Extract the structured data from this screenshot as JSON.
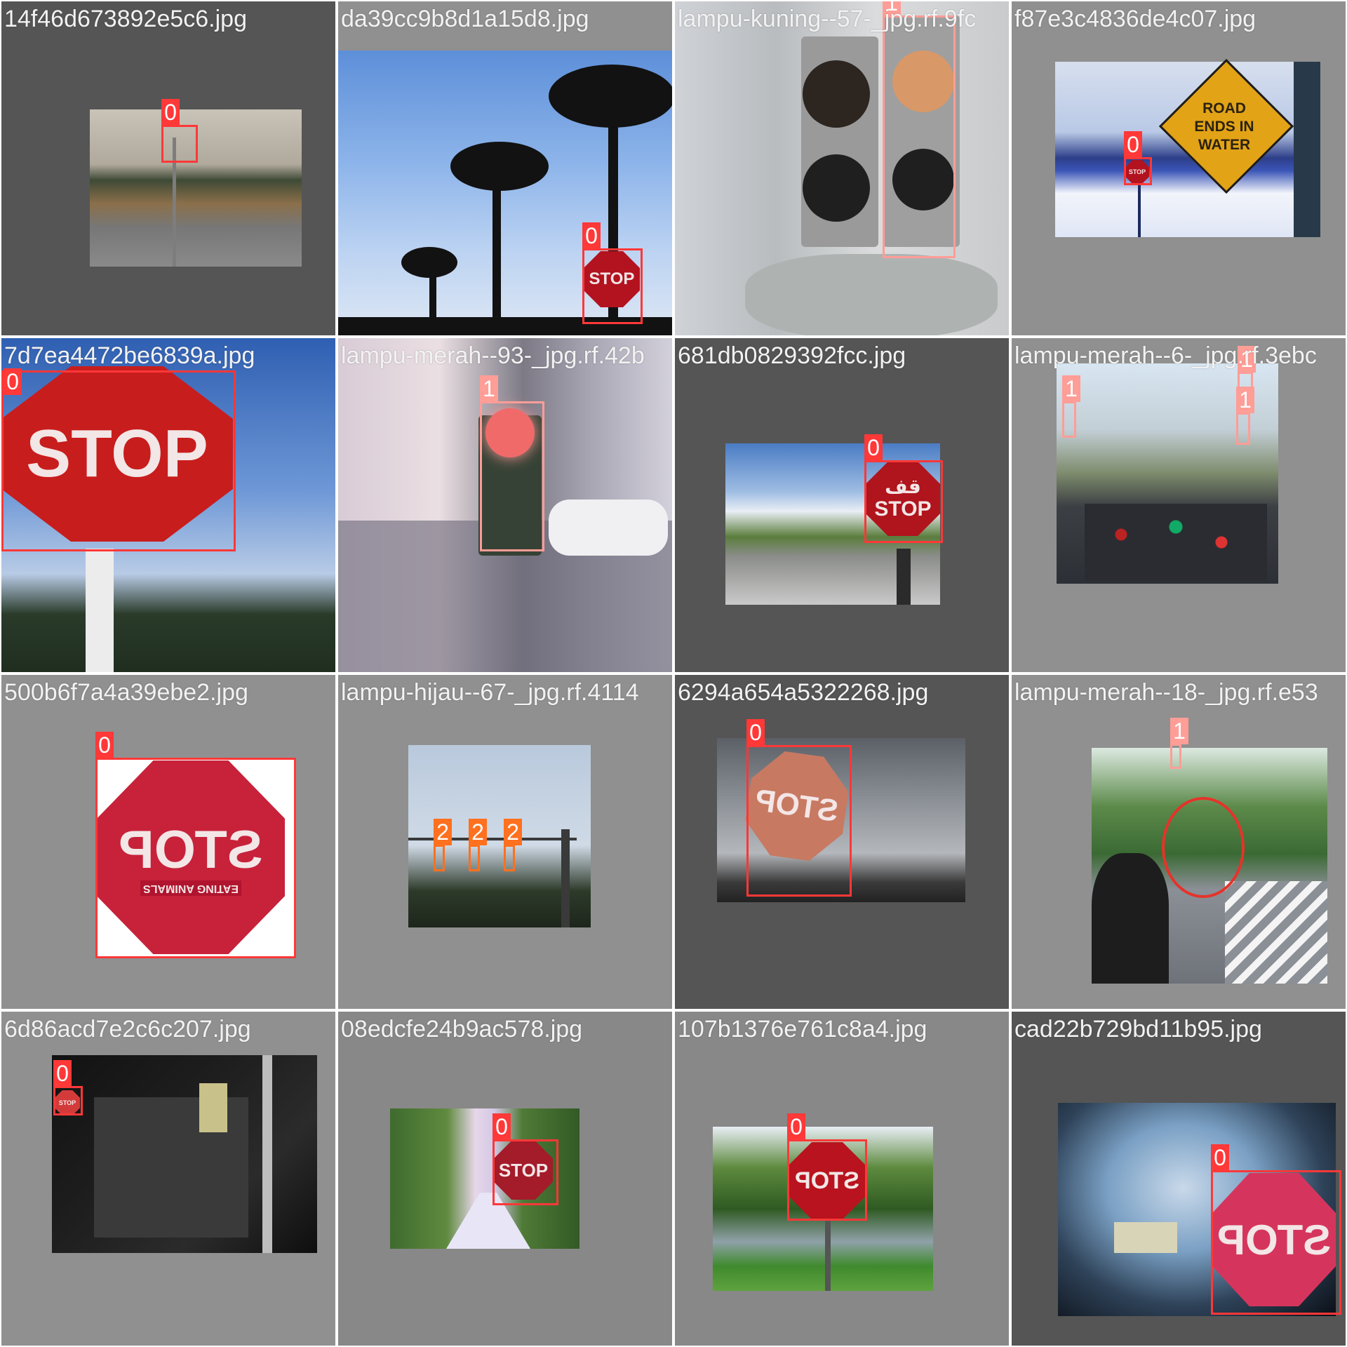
{
  "tiles": [
    {
      "filename": "14f46d673892e5c6.jpg",
      "labels": [
        "0"
      ]
    },
    {
      "filename": "da39cc9b8d1a15d8.jpg",
      "labels": [
        "0"
      ]
    },
    {
      "filename": "lampu-kuning--57-_jpg.rf.9fc",
      "labels": [
        "1"
      ],
      "overlap_filename": "f87e3c4836de4c07.jpg"
    },
    {
      "filename": "f87e3c4836de4c07.jpg",
      "labels": [
        "0"
      ],
      "sign_text": "ROAD ENDS IN WATER"
    },
    {
      "filename": "7d7ea4472be6839a.jpg",
      "labels": [
        "0"
      ]
    },
    {
      "filename": "lampu-merah--93-_jpg.rf.42b",
      "labels": [
        "1"
      ],
      "overlap_filename": "681db0829392fcc.jpg"
    },
    {
      "filename": "681db0829392fcc.jpg",
      "labels": [
        "0"
      ],
      "sign_text_top": "قف"
    },
    {
      "filename": "lampu-merah--6-_jpg.rf.3ebc",
      "labels": [
        "1",
        "1",
        "1"
      ]
    },
    {
      "filename": "500b6f7a4a39ebe2.jpg",
      "labels": [
        "0"
      ],
      "sign_sub": "EATING ANIMALS"
    },
    {
      "filename": "lampu-hijau--67-_jpg.rf.4114",
      "labels": [
        "2",
        "2",
        "2"
      ],
      "overlap_filename": "6294a654a5322268.jpg"
    },
    {
      "filename": "6294a654a5322268.jpg",
      "labels": [
        "0"
      ]
    },
    {
      "filename": "lampu-merah--18-_jpg.rf.e53",
      "labels": [
        "1"
      ]
    },
    {
      "filename": "6d86acd7e2c6c207.jpg",
      "labels": [
        "0"
      ]
    },
    {
      "filename": "08edcfe24b9ac578.jpg",
      "labels": [
        "0"
      ]
    },
    {
      "filename": "107b1376e761c8a4.jpg",
      "labels": [
        "0"
      ]
    },
    {
      "filename": "cad22b729bd11b95.jpg",
      "labels": [
        "0"
      ]
    }
  ],
  "sign_word": "STOP",
  "class_colors": {
    "0": "#ff3838",
    "1": "#ff9d97",
    "2": "#ff701f"
  }
}
